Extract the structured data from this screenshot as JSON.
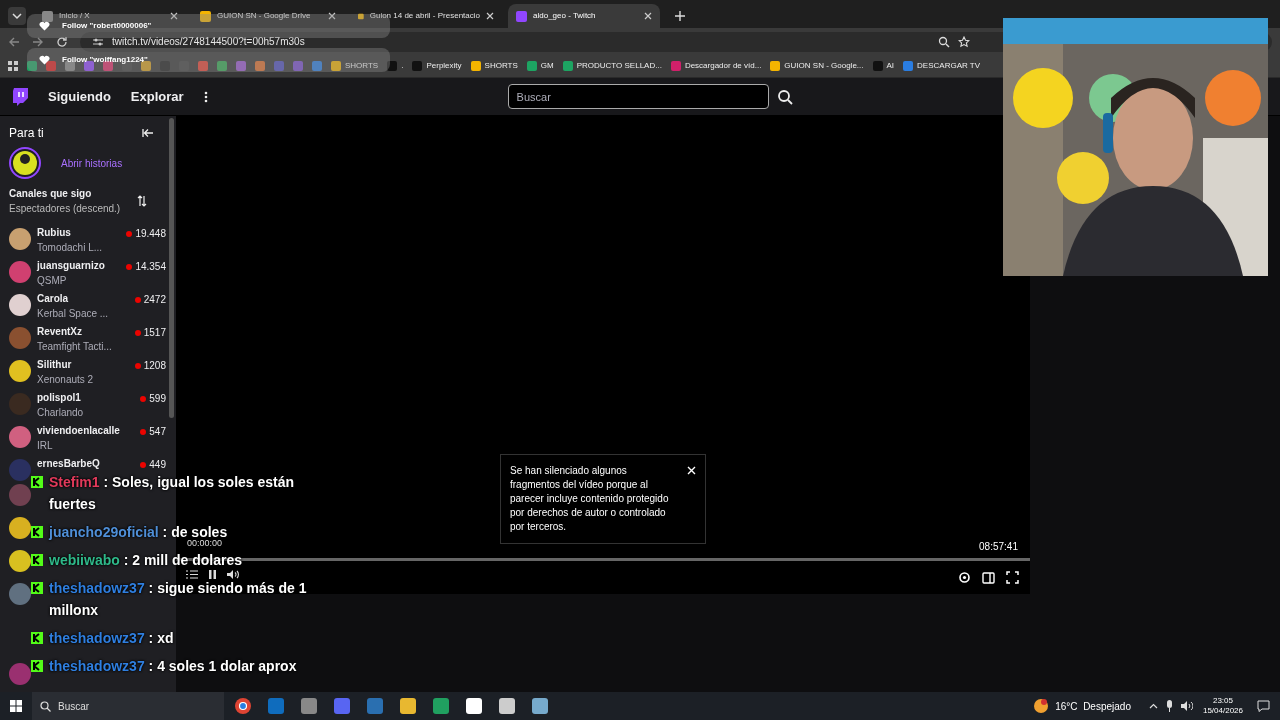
{
  "browser": {
    "tabs": [
      {
        "title": "Inicio / X",
        "selected": false
      },
      {
        "title": "GUION SN - Google Drive",
        "selected": false
      },
      {
        "title": "Guion 14 de abril - Presentacio",
        "selected": false
      },
      {
        "title": "aldo_geo - Twitch",
        "selected": true
      }
    ],
    "url": "twitch.tv/videos/2748144500?t=00h57m30s",
    "bookmarks": [
      {
        "label": "SHORTS",
        "kind": "drive"
      },
      {
        "label": ".",
        "kind": "dark"
      },
      {
        "label": "Perplexity",
        "kind": "dark"
      },
      {
        "label": "SHORTS",
        "kind": "drive"
      },
      {
        "label": "GM",
        "kind": "sheet"
      },
      {
        "label": "PRODUCTO SELLAD...",
        "kind": "sheet"
      },
      {
        "label": "Descargador de víd...",
        "kind": "pink"
      },
      {
        "label": "GUION SN - Google...",
        "kind": "drive"
      },
      {
        "label": "AI",
        "kind": "dark"
      },
      {
        "label": "DESCARGAR TV",
        "kind": "blue"
      }
    ]
  },
  "toasts": [
    "Follow \"robert0000006\"",
    "Follow \"wolffang1224\""
  ],
  "nav": {
    "links": [
      "Siguiendo",
      "Explorar"
    ],
    "search": {
      "placeholder": "Buscar"
    }
  },
  "sidebar": {
    "title": "Para ti",
    "stories": "Abrir historias",
    "section": "Canales que sigo",
    "sort": "Espectadores (descend.)",
    "channels": [
      {
        "name": "Rubius",
        "game": "Tomodachi L...",
        "viewers": "19.448"
      },
      {
        "name": "juansguarnizo",
        "game": "QSMP",
        "viewers": "14.354"
      },
      {
        "name": "Carola",
        "game": "Kerbal Space ...",
        "viewers": "2472"
      },
      {
        "name": "ReventXz",
        "game": "Teamfight Tacti...",
        "viewers": "1517"
      },
      {
        "name": "Silithur",
        "game": "Xenonauts 2",
        "viewers": "1208"
      },
      {
        "name": "polispol1",
        "game": "Charlando",
        "viewers": "599"
      },
      {
        "name": "viviendoenlacalle",
        "game": "IRL",
        "viewers": "547"
      },
      {
        "name": "ernesBarbeQ",
        "viewers": "449"
      }
    ]
  },
  "player": {
    "notice": "Se han silenciado algunos fragmentos del vídeo porque al parecer incluye contenido protegido por derechos de autor o controlado por terceros.",
    "elapsed": "00:00:00",
    "duration": "08:57:41"
  },
  "chat": [
    {
      "user": "Stefim1",
      "color": "#e23a5b",
      "text": ": Soles, igual los soles están fuertes"
    },
    {
      "user": "juancho29oficial",
      "color": "#4f8fd8",
      "text": ": de soles"
    },
    {
      "user": "webiiwabo",
      "color": "#2fb98a",
      "text": ": 2 mill de dolares"
    },
    {
      "user": "theshadowz37",
      "color": "#2f7fe0",
      "text": ": sigue siendo más de 1 millonx"
    },
    {
      "user": "theshadowz37",
      "color": "#2f7fe0",
      "text": ": xd"
    },
    {
      "user": "theshadowz37",
      "color": "#2f7fe0",
      "text": ": 4 soles 1 dolar aprox"
    }
  ],
  "taskbar": {
    "search": {
      "placeholder": "Buscar"
    },
    "weather": "16°C  Despejado",
    "time": "23:05",
    "date": "15/04/2026"
  }
}
